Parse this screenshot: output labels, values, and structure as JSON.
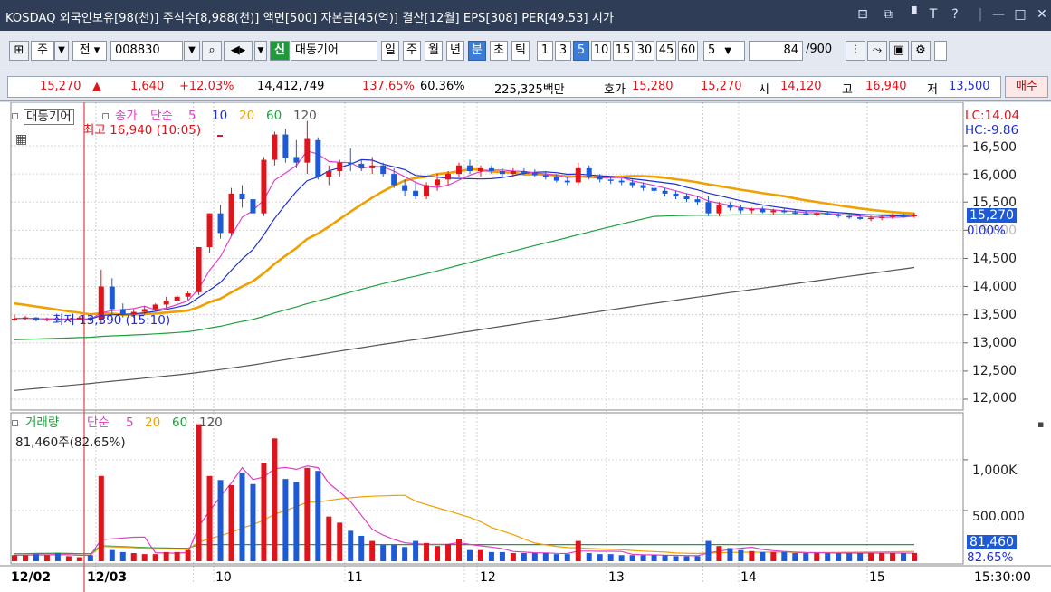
{
  "title_bar": {
    "text": "KOSDAQ 외국인보유[98(천)] 주식수[8,988(천)] 액면[500] 자본금[45(억)] 결산[12월] EPS[308] PER[49.53] 시가",
    "icons": [
      "restore-icon",
      "popup-icon",
      "pin-icon",
      "font-icon",
      "help-icon",
      "minimize-icon",
      "maximize-icon",
      "close-icon"
    ]
  },
  "toolbar": {
    "day_mode": "주",
    "prev": "전",
    "code": "008830",
    "badge": "신",
    "name": "대동기어",
    "periods": [
      "일",
      "주",
      "월",
      "년",
      "분",
      "초",
      "틱"
    ],
    "active_period": "분",
    "intervals": [
      "1",
      "3",
      "5",
      "10",
      "15",
      "30",
      "45",
      "60"
    ],
    "active_interval": "5",
    "interval_select": "5",
    "count": "84",
    "total": "/900"
  },
  "quote": {
    "price": "15,270",
    "direction": "▲",
    "change": "1,640",
    "change_pct": "+12.03%",
    "volume": "14,412,749",
    "vol_ratio": "137.65%",
    "turnover": "60.36%",
    "amount": "225,325백만",
    "hoga_label": "호가",
    "hoga_ask": "15,280",
    "hoga_bid": "15,270",
    "open_label": "시",
    "open": "14,120",
    "high_label": "고",
    "high": "16,940",
    "low_label": "저",
    "low": "13,500",
    "trade_button": "매수"
  },
  "price_panel": {
    "stock_label": "대동기어",
    "legend_close": "종가",
    "legend_type": "단순",
    "ma": [
      "5",
      "10",
      "20",
      "60",
      "120"
    ],
    "high_note": "최고 16,940 (10:05)",
    "low_note": "최저 13,390 (15:10)",
    "lc": "LC:14.04",
    "hc": "HC:-9.86",
    "y_ticks": [
      "16,500",
      "16,000",
      "15,500",
      "15,000",
      "14,500",
      "14,000",
      "13,500",
      "13,000",
      "12,500",
      "12,000"
    ],
    "current_price": "15,270",
    "current_pct": "0.00%"
  },
  "volume_panel": {
    "label": "거래량",
    "legend_type": "단순",
    "ma": [
      "5",
      "20",
      "60",
      "120"
    ],
    "last_volume": "81,460주(82.65%)",
    "y_ticks": [
      "1,000K",
      "500,000"
    ],
    "current_volume": "81,460",
    "current_pct": "82.65%"
  },
  "x_axis": {
    "labels": [
      "12/02",
      "12/03",
      "10",
      "11",
      "12",
      "13",
      "14",
      "15"
    ],
    "time": "15:30:00"
  },
  "colors": {
    "up": "#e0141a",
    "down": "#1d5bd6",
    "ma5": "#e040c8",
    "ma10": "#1f2fd0",
    "ma20": "#f0a000",
    "ma60": "#1ea03c",
    "ma120": "#555555"
  },
  "chart_data": {
    "type": "candlestick",
    "panels": [
      "price",
      "volume"
    ],
    "price_range": [
      12000,
      16940
    ],
    "candles": [
      [
        13420,
        13500,
        13390,
        13430
      ],
      [
        13430,
        13480,
        13400,
        13450
      ],
      [
        13450,
        13460,
        13380,
        13410
      ],
      [
        13410,
        13450,
        13380,
        13420
      ],
      [
        13420,
        13440,
        13390,
        13400
      ],
      [
        13400,
        13430,
        13380,
        13420
      ],
      [
        13420,
        13480,
        13400,
        13450
      ],
      [
        13450,
        13460,
        13380,
        13400
      ],
      [
        13400,
        14300,
        13350,
        14000
      ],
      [
        14000,
        14150,
        13500,
        13600
      ],
      [
        13600,
        13700,
        13450,
        13500
      ],
      [
        13500,
        13600,
        13450,
        13550
      ],
      [
        13550,
        13650,
        13500,
        13600
      ],
      [
        13600,
        13700,
        13550,
        13680
      ],
      [
        13680,
        13820,
        13620,
        13750
      ],
      [
        13750,
        13850,
        13700,
        13820
      ],
      [
        13820,
        13920,
        13760,
        13880
      ],
      [
        13900,
        14700,
        13850,
        14700
      ],
      [
        14700,
        15300,
        14600,
        15300
      ],
      [
        15300,
        15450,
        14850,
        14950
      ],
      [
        14950,
        15750,
        14900,
        15650
      ],
      [
        15650,
        15800,
        15400,
        15550
      ],
      [
        15550,
        15800,
        15300,
        15300
      ],
      [
        15300,
        16300,
        15250,
        16250
      ],
      [
        16250,
        16750,
        16150,
        16700
      ],
      [
        16700,
        16800,
        16200,
        16280
      ],
      [
        16300,
        16600,
        16100,
        16200
      ],
      [
        16200,
        16940,
        16000,
        16620
      ],
      [
        16600,
        16650,
        15900,
        15950
      ],
      [
        15950,
        16150,
        15800,
        16050
      ],
      [
        16050,
        16250,
        15950,
        16200
      ],
      [
        16200,
        16450,
        16050,
        16180
      ],
      [
        16180,
        16250,
        16050,
        16100
      ],
      [
        16100,
        16300,
        16000,
        16150
      ],
      [
        16150,
        16200,
        15950,
        16000
      ],
      [
        16000,
        16100,
        15750,
        15800
      ],
      [
        15800,
        15900,
        15600,
        15700
      ],
      [
        15700,
        15850,
        15550,
        15600
      ],
      [
        15600,
        15850,
        15550,
        15800
      ],
      [
        15800,
        16000,
        15700,
        15900
      ],
      [
        15900,
        16050,
        15800,
        16000
      ],
      [
        16000,
        16200,
        15950,
        16150
      ],
      [
        16150,
        16250,
        16000,
        16050
      ],
      [
        16050,
        16150,
        15950,
        16100
      ],
      [
        16100,
        16150,
        16000,
        16050
      ],
      [
        16050,
        16100,
        15950,
        16000
      ],
      [
        16000,
        16100,
        15950,
        16050
      ],
      [
        16050,
        16100,
        15980,
        16020
      ],
      [
        16020,
        16080,
        15950,
        15980
      ],
      [
        15980,
        16050,
        15900,
        15950
      ],
      [
        15950,
        16000,
        15850,
        15880
      ],
      [
        15880,
        15950,
        15800,
        15850
      ],
      [
        15850,
        16200,
        15800,
        16100
      ],
      [
        16100,
        16150,
        15900,
        15950
      ],
      [
        15950,
        16000,
        15850,
        15900
      ],
      [
        15900,
        15950,
        15820,
        15880
      ],
      [
        15880,
        15920,
        15800,
        15850
      ],
      [
        15850,
        15900,
        15750,
        15800
      ],
      [
        15800,
        15850,
        15700,
        15750
      ],
      [
        15750,
        15800,
        15650,
        15700
      ],
      [
        15700,
        15750,
        15600,
        15650
      ],
      [
        15650,
        15700,
        15550,
        15600
      ],
      [
        15600,
        15650,
        15500,
        15550
      ],
      [
        15550,
        15600,
        15450,
        15500
      ],
      [
        15500,
        15600,
        15250,
        15300
      ],
      [
        15300,
        15500,
        15250,
        15450
      ],
      [
        15450,
        15500,
        15350,
        15400
      ],
      [
        15400,
        15450,
        15300,
        15350
      ],
      [
        15350,
        15400,
        15300,
        15380
      ],
      [
        15380,
        15420,
        15300,
        15320
      ],
      [
        15320,
        15380,
        15280,
        15350
      ],
      [
        15350,
        15400,
        15300,
        15320
      ],
      [
        15320,
        15360,
        15280,
        15300
      ],
      [
        15300,
        15340,
        15260,
        15280
      ],
      [
        15280,
        15320,
        15240,
        15300
      ],
      [
        15300,
        15340,
        15260,
        15280
      ],
      [
        15280,
        15300,
        15220,
        15250
      ],
      [
        15250,
        15300,
        15200,
        15230
      ],
      [
        15230,
        15280,
        15180,
        15200
      ],
      [
        15200,
        15260,
        15160,
        15220
      ],
      [
        15220,
        15280,
        15180,
        15240
      ],
      [
        15240,
        15300,
        15200,
        15260
      ],
      [
        15260,
        15300,
        15220,
        15250
      ],
      [
        15250,
        15310,
        15220,
        15270
      ]
    ],
    "volume_range": [
      0,
      1400000
    ],
    "volume": [
      60000,
      60000,
      70000,
      60000,
      80000,
      50000,
      40000,
      60000,
      840000,
      110000,
      90000,
      80000,
      70000,
      70000,
      90000,
      90000,
      110000,
      1350000,
      840000,
      800000,
      750000,
      870000,
      760000,
      970000,
      1210000,
      810000,
      780000,
      920000,
      890000,
      440000,
      380000,
      300000,
      250000,
      200000,
      160000,
      160000,
      140000,
      200000,
      180000,
      150000,
      170000,
      220000,
      110000,
      110000,
      90000,
      90000,
      80000,
      80000,
      80000,
      80000,
      70000,
      70000,
      200000,
      80000,
      70000,
      70000,
      60000,
      60000,
      60000,
      60000,
      60000,
      50000,
      50000,
      50000,
      200000,
      150000,
      130000,
      110000,
      100000,
      90000,
      90000,
      90000,
      80000,
      80000,
      80000,
      80000,
      80000,
      80000,
      80000,
      80000,
      80000,
      80000,
      80000,
      81460
    ]
  }
}
